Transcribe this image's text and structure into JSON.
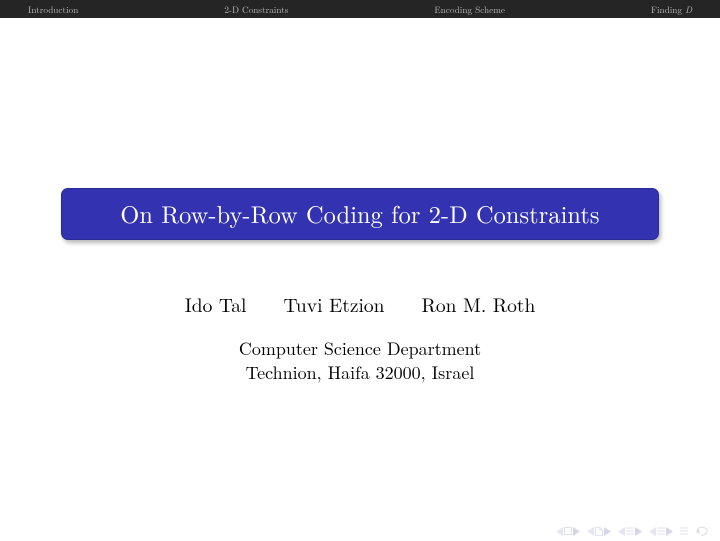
{
  "nav": {
    "items": [
      "Introduction",
      "2-D Constraints",
      "Encoding Scheme"
    ],
    "last_prefix": "Finding ",
    "last_italic": "D"
  },
  "title": "On Row-by-Row Coding for 2-D Constraints",
  "authors": [
    "Ido Tal",
    "Tuvi Etzion",
    "Ron M. Roth"
  ],
  "affiliation": {
    "line1": "Computer Science Department",
    "line2": "Technion, Haifa 32000, Israel"
  },
  "footer_icons": {
    "first": "first-slide-icon",
    "prev": "prev-slide-icon",
    "prev_step": "prev-step-icon",
    "next_step": "next-step-icon",
    "last": "last-slide-icon",
    "home": "home-icon"
  }
}
